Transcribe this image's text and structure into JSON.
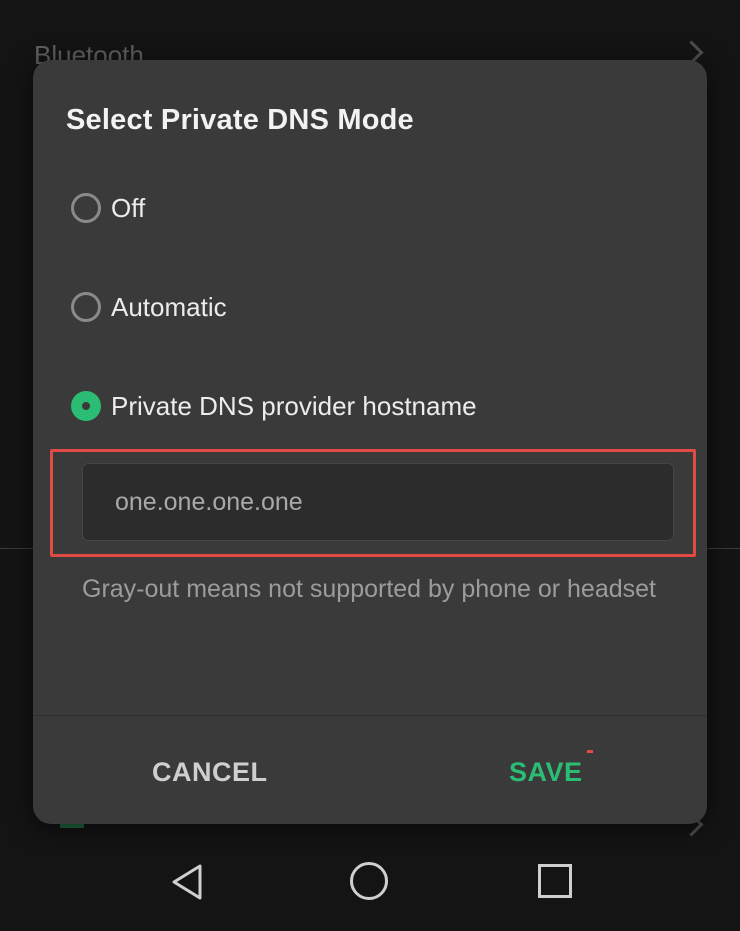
{
  "background": {
    "top_item": "Bluetooth",
    "bottom_item": "..."
  },
  "dialog": {
    "title": "Select Private DNS Mode",
    "options": [
      {
        "label": "Off",
        "selected": false
      },
      {
        "label": "Automatic",
        "selected": false
      },
      {
        "label": "Private DNS provider hostname",
        "selected": true
      }
    ],
    "hostname_value": "one.one.one.one",
    "hint": "Gray-out means not supported by phone or headset",
    "cancel_label": "CANCEL",
    "save_label": "SAVE"
  },
  "colors": {
    "accent_green": "#2bbd73",
    "highlight_red": "#e24a45",
    "dialog_bg": "#3a3a3a"
  },
  "icons": {
    "nav_back": "back-triangle-icon",
    "nav_home": "home-circle-icon",
    "nav_recents": "recents-square-icon"
  }
}
